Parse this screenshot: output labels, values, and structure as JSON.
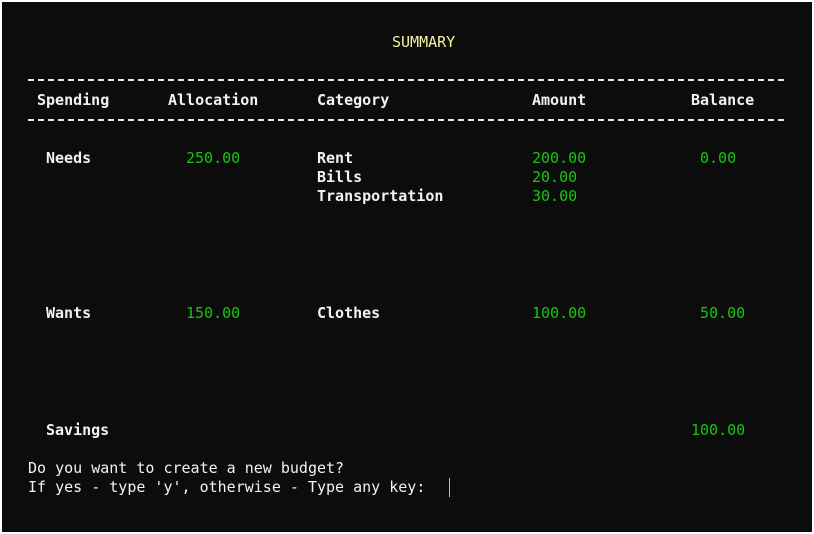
{
  "summary": {
    "title": "SUMMARY",
    "headers": {
      "spending": "Spending",
      "allocation": "Allocation",
      "category": "Category",
      "amount": "Amount",
      "balance": "Balance"
    },
    "needs": {
      "spending": "Needs",
      "allocation": "250.00",
      "categories": [
        "Rent",
        "Bills",
        "Transportation"
      ],
      "amounts": [
        "200.00",
        "20.00",
        "30.00"
      ],
      "balance": "0.00"
    },
    "wants": {
      "spending": "Wants",
      "allocation": "150.00",
      "categories": [
        "Clothes"
      ],
      "amounts": [
        "100.00"
      ],
      "balance": "50.00"
    },
    "savings": {
      "spending": "Savings",
      "balance": "100.00"
    }
  },
  "prompt": {
    "line1": "Do you want to create a new budget?",
    "line2": "If yes - type 'y', otherwise - Type any key: "
  },
  "colors": {
    "background": "#0c0c0c",
    "text": "#f2f2f2",
    "title": "#f9f1a5",
    "values": "#16c60c"
  }
}
